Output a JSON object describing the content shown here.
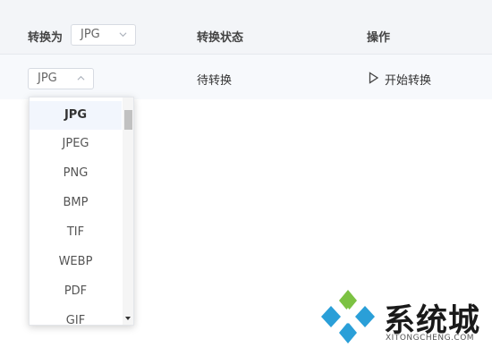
{
  "header": {
    "convert_to_label": "转换为",
    "format_select_value": "JPG",
    "status_label": "转换状态",
    "action_label": "操作"
  },
  "row": {
    "format_select_value": "JPG",
    "status_text": "待转换",
    "start_label": "开始转换"
  },
  "dropdown": {
    "selected": "JPG",
    "options": [
      "JPG",
      "JPEG",
      "PNG",
      "BMP",
      "TIF",
      "WEBP",
      "PDF",
      "GIF"
    ]
  },
  "watermark": {
    "name": "系统城",
    "site": "XITONGCHENG.COM"
  },
  "colors": {
    "header_bg": "#f3f5f8",
    "selected_bg": "#f2f6fd",
    "logo_blue": "#2a9fd8",
    "logo_green": "#7cc242"
  }
}
